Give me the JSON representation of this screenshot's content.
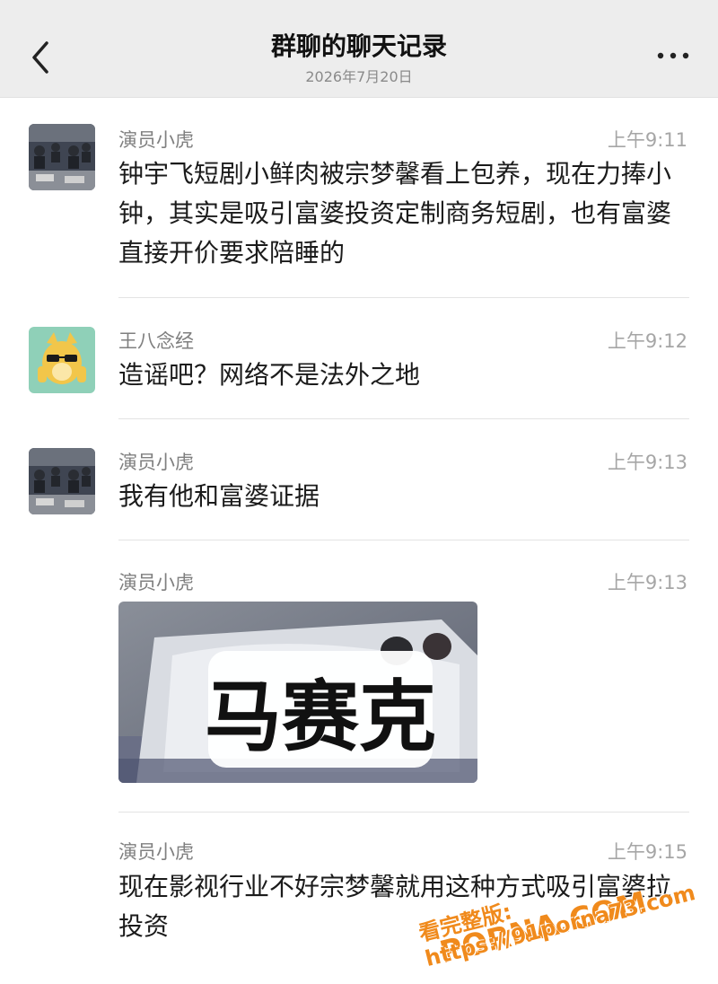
{
  "header": {
    "title": "群聊的聊天记录",
    "date": "2026年7月20日",
    "back_icon": "chevron-left-icon",
    "more_icon": "more-dots-icon"
  },
  "messages": [
    {
      "sender": "演员小虎",
      "time": "上午9:11",
      "text": "钟宇飞短剧小鲜肉被宗梦馨看上包养，现在力捧小钟，其实是吸引富婆投资定制商务短剧，也有富婆直接开价要求陪睡的"
    },
    {
      "sender": "王八念经",
      "time": "上午9:12",
      "text": "造谣吧？网络不是法外之地"
    },
    {
      "sender": "演员小虎",
      "time": "上午9:13",
      "text": "我有他和富婆证据"
    },
    {
      "sender": "演员小虎",
      "time": "上午9:13",
      "image_overlay_text": "马赛克"
    },
    {
      "sender": "演员小虎",
      "time": "上午9:15",
      "text": "现在影视行业不好宗梦馨就用这种方式吸引富婆拉投资"
    }
  ],
  "watermark": {
    "brand": "PORNA.COM",
    "note": "看完整版: https://91porna73.com"
  },
  "colors": {
    "header_bg": "#ededed",
    "watermark": "#f08a1c"
  }
}
